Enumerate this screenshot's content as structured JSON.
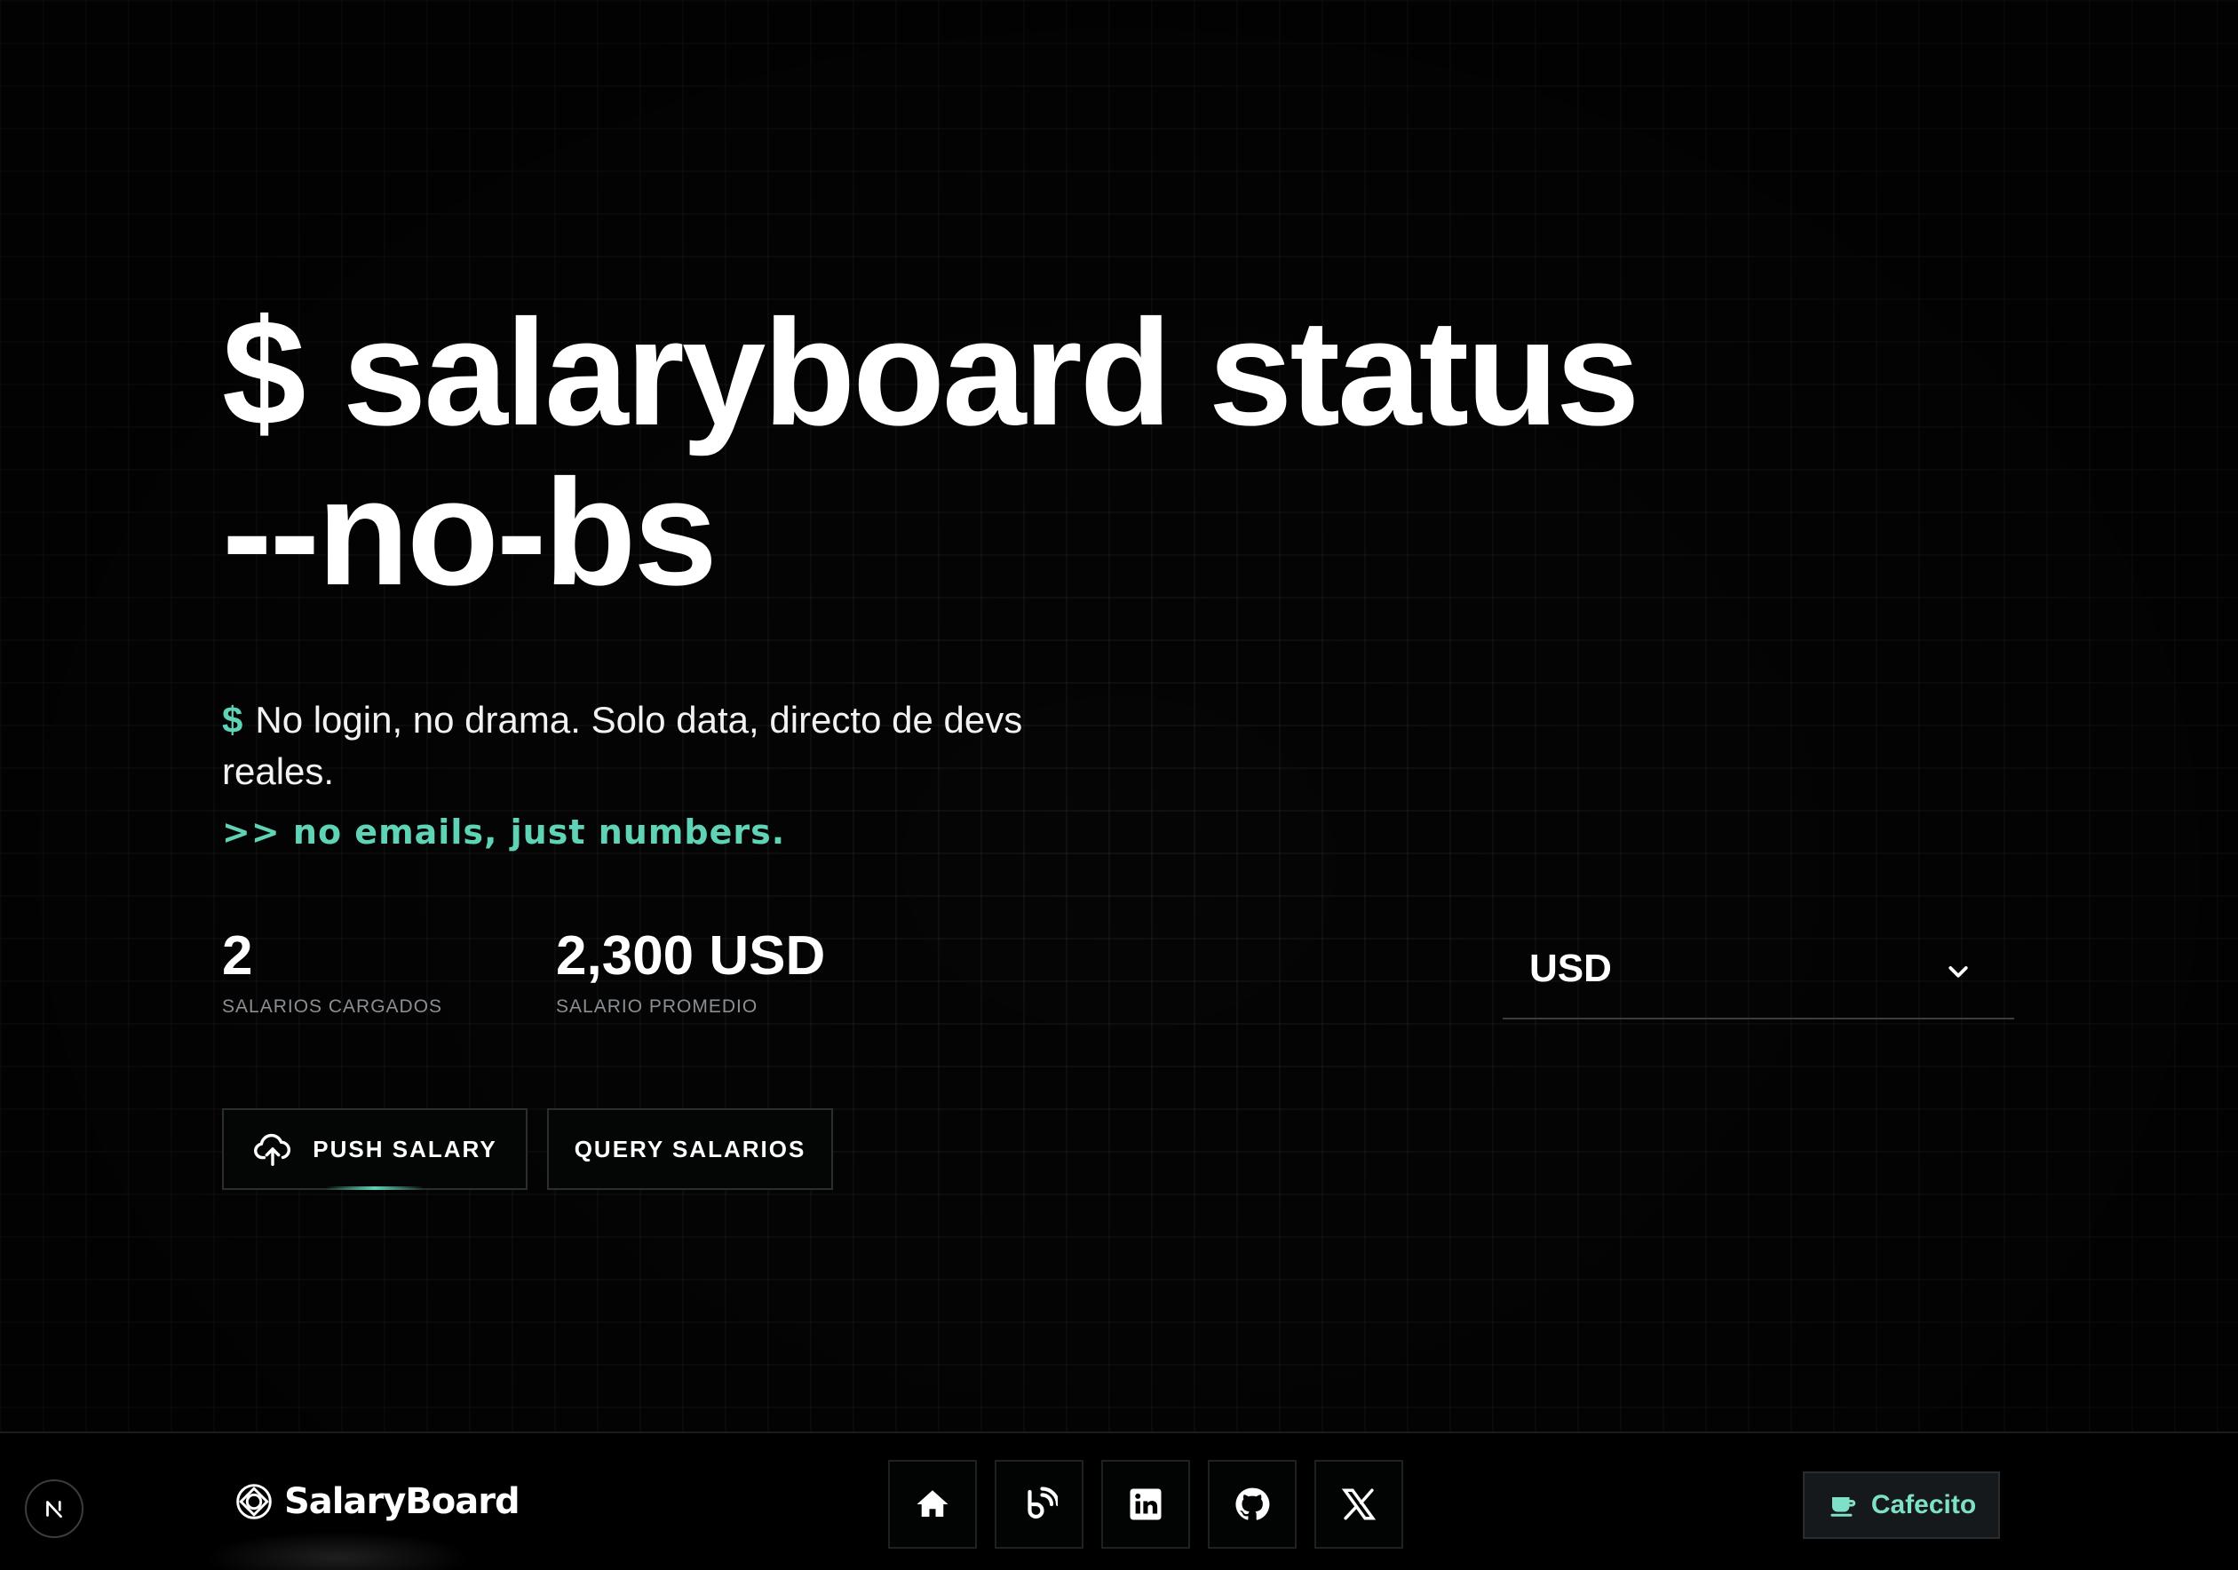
{
  "hero": {
    "title_line1": "$ salaryboard status",
    "title_line2": "--no-bs",
    "description_prompt": "$",
    "description": "No login, no drama. Solo data, directo de devs reales.",
    "tagline": ">> no emails, just numbers."
  },
  "stats": [
    {
      "value": "2",
      "label": "SALARIOS CARGADOS"
    },
    {
      "value": "2,300 USD",
      "label": "SALARIO PROMEDIO"
    }
  ],
  "currency_select": {
    "selected": "USD",
    "icon": "chevron-down-icon"
  },
  "actions": {
    "push_label": "PUSH SALARY",
    "push_icon": "cloud-upload-icon",
    "query_label": "QUERY SALARIOS"
  },
  "footer": {
    "brand_name": "SalaryBoard",
    "brand_icon": "salaryboard-logo-icon",
    "socials": [
      {
        "name": "home",
        "icon": "home-icon"
      },
      {
        "name": "blog",
        "icon": "blog-icon"
      },
      {
        "name": "linkedin",
        "icon": "linkedin-icon"
      },
      {
        "name": "github",
        "icon": "github-icon"
      },
      {
        "name": "x",
        "icon": "x-icon"
      }
    ],
    "cafecito_label": "Cafecito",
    "cafecito_icon": "coffee-icon"
  },
  "dev_badge": {
    "icon": "nextjs-icon"
  },
  "colors": {
    "accent": "#5fd3b5",
    "background": "#050505",
    "muted_text": "#8a8f94"
  }
}
